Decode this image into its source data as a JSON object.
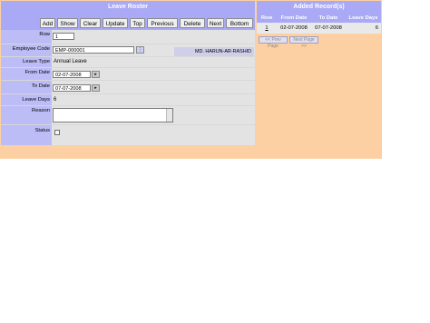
{
  "form": {
    "title": "Leave Roster",
    "buttons": [
      "Add",
      "Show",
      "Clear",
      "Update",
      "Top",
      "Previous",
      "Delete",
      "Next",
      "Bottom"
    ],
    "fields": {
      "row_label": "Row",
      "row_value": "1",
      "employee_code_label": "Employee Code",
      "employee_code_value": "EMP-000001",
      "employee_name": "MD. HARUN-AR-RASHID",
      "leave_type_label": "Leave Type",
      "leave_type_value": "Annual Leave",
      "from_date_label": "From Date",
      "from_date_value": "02-07-2008",
      "to_date_label": "To Date",
      "to_date_value": "07-07-2008",
      "leave_days_label": "Leave Days",
      "leave_days_value": "6",
      "reason_label": "Reason",
      "reason_value": "",
      "status_label": "Status",
      "status_checked": false
    },
    "icons": {
      "lookup": "search-icon",
      "date_picker": "calendar-icon"
    }
  },
  "records": {
    "title": "Added Record(s)",
    "columns": [
      "Row",
      "From Date",
      "To Date",
      "Leave Days"
    ],
    "rows": [
      {
        "row": "1",
        "from": "02-07-2008",
        "to": "07-07-2008",
        "days": "6"
      }
    ],
    "prev_page": "<< Prev Page",
    "next_page": "Next Page >>"
  },
  "colors": {
    "background": "#fcd0a2",
    "header": "#a9a9f5",
    "label_column": "#bcbcf7",
    "value_column": "#e3e3e3"
  }
}
